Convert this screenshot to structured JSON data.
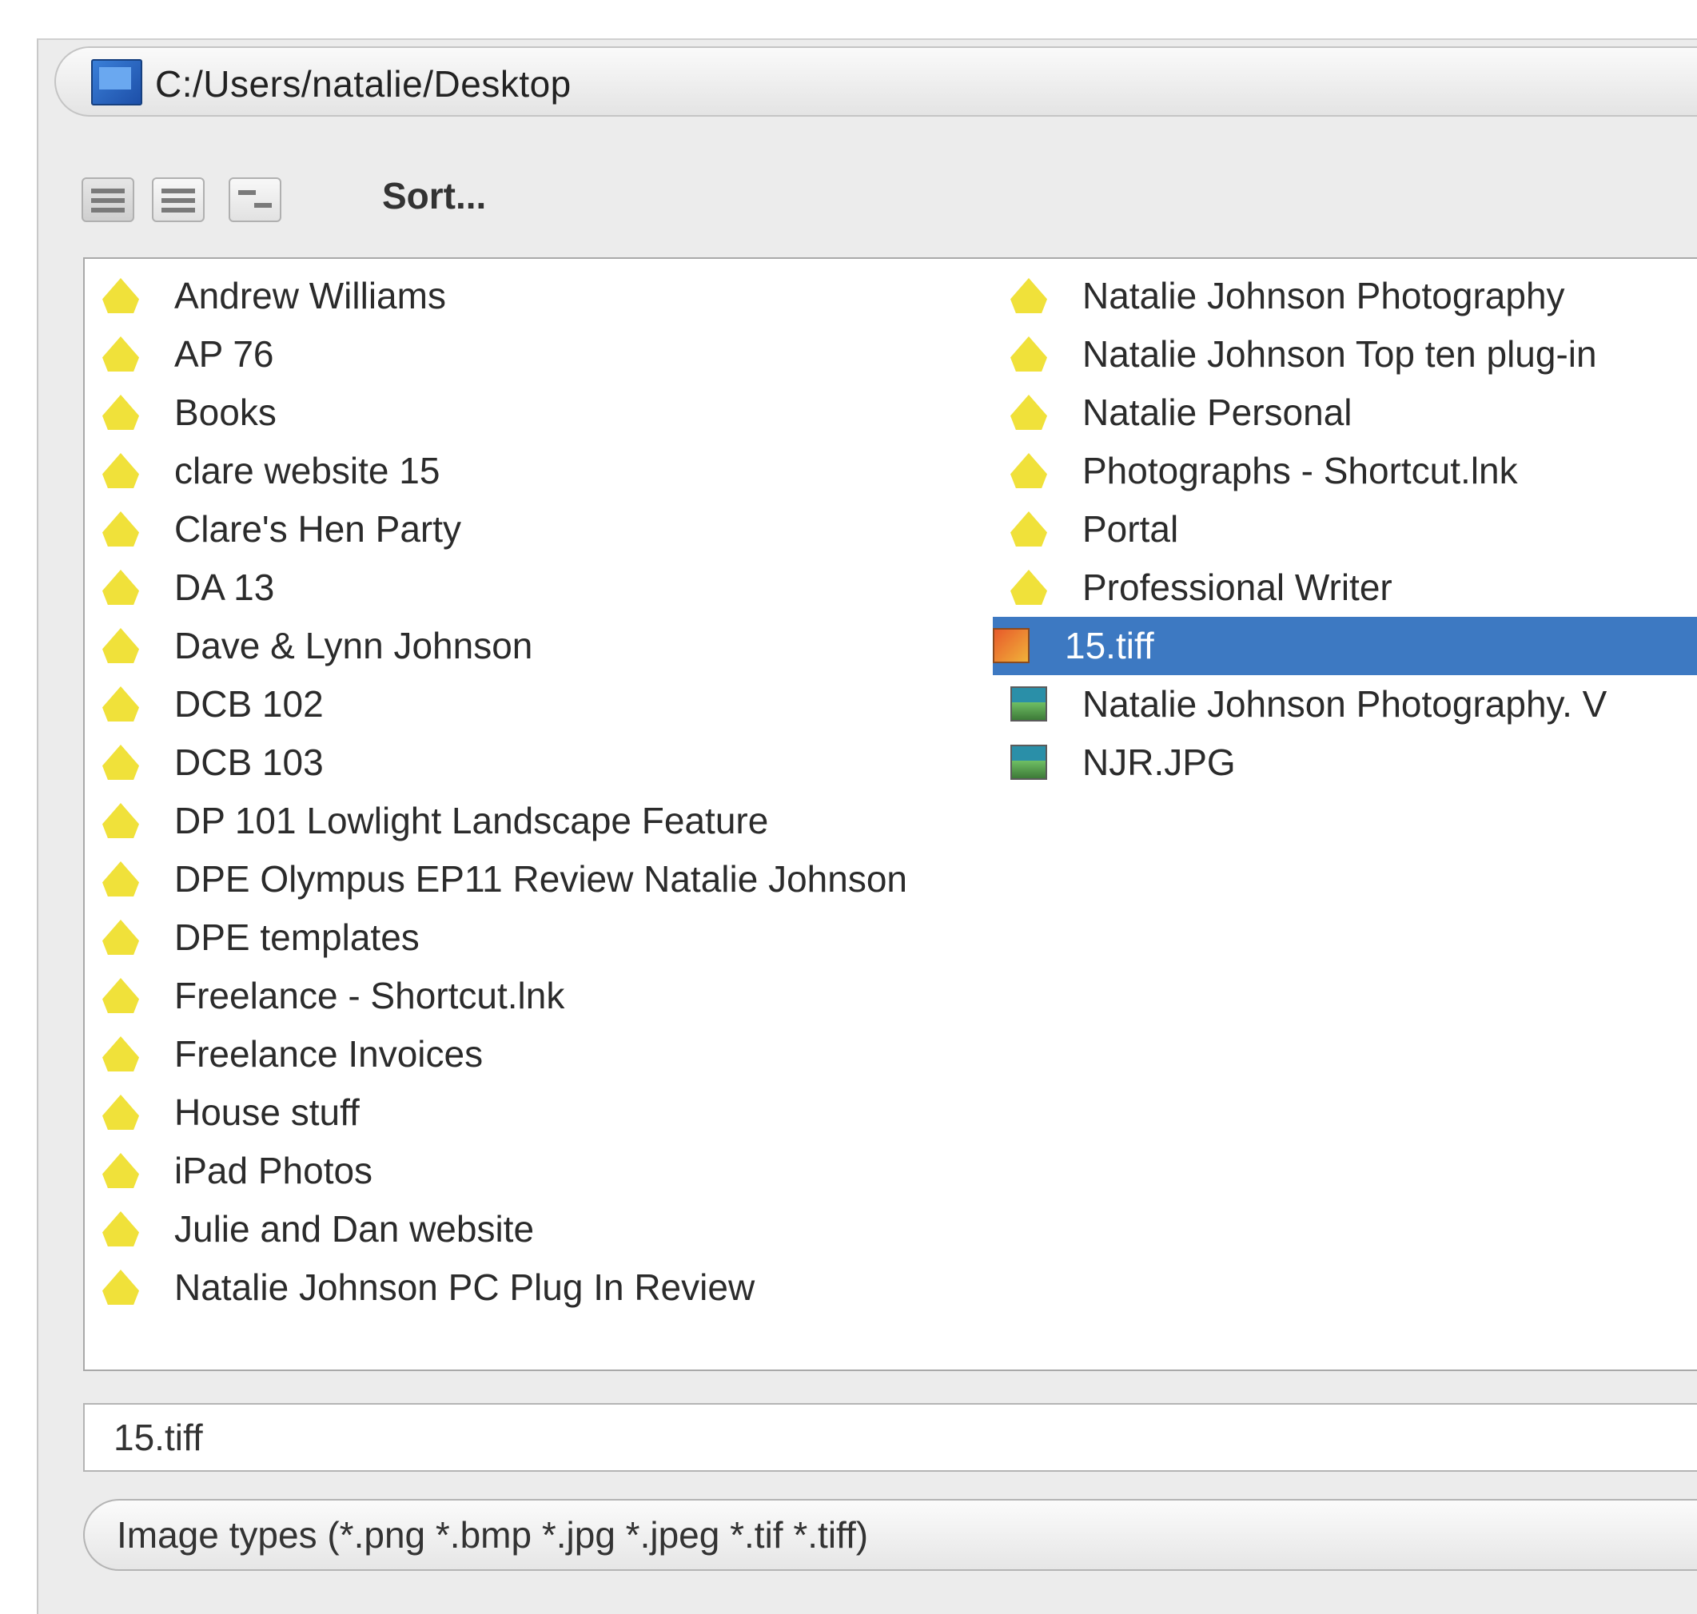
{
  "address_bar": {
    "path": "C:/Users/natalie/Desktop"
  },
  "toolbar": {
    "sort_label": "Sort..."
  },
  "files": {
    "column1": [
      {
        "name": "Andrew Williams",
        "icon": "folder-icon"
      },
      {
        "name": "AP 76",
        "icon": "folder-icon"
      },
      {
        "name": "Books",
        "icon": "folder-icon"
      },
      {
        "name": "clare website 15",
        "icon": "folder-icon"
      },
      {
        "name": "Clare's Hen Party",
        "icon": "folder-icon"
      },
      {
        "name": "DA 13",
        "icon": "folder-icon"
      },
      {
        "name": "Dave & Lynn Johnson",
        "icon": "folder-icon"
      },
      {
        "name": "DCB 102",
        "icon": "folder-icon"
      },
      {
        "name": "DCB 103",
        "icon": "folder-icon"
      },
      {
        "name": "DP 101 Lowlight Landscape Feature",
        "icon": "folder-icon"
      },
      {
        "name": "DPE Olympus EP11 Review Natalie Johnson",
        "icon": "folder-icon"
      },
      {
        "name": "DPE templates",
        "icon": "folder-icon"
      },
      {
        "name": "Freelance - Shortcut.lnk",
        "icon": "folder-icon"
      },
      {
        "name": "Freelance Invoices",
        "icon": "folder-icon"
      },
      {
        "name": "House stuff",
        "icon": "folder-icon"
      },
      {
        "name": "iPad Photos",
        "icon": "folder-icon"
      },
      {
        "name": "Julie and Dan website",
        "icon": "folder-icon"
      },
      {
        "name": "Natalie Johnson PC Plug In Review",
        "icon": "folder-icon"
      }
    ],
    "column2": [
      {
        "name": "Natalie Johnson Photography",
        "icon": "folder-icon"
      },
      {
        "name": "Natalie Johnson Top ten plug-in",
        "icon": "folder-icon"
      },
      {
        "name": "Natalie Personal",
        "icon": "folder-icon"
      },
      {
        "name": "Photographs - Shortcut.lnk",
        "icon": "folder-icon"
      },
      {
        "name": "Portal",
        "icon": "folder-icon"
      },
      {
        "name": "Professional Writer",
        "icon": "folder-icon"
      },
      {
        "name": "15.tiff",
        "icon": "tiff-image-icon",
        "selected": true
      },
      {
        "name": "Natalie Johnson Photography. V",
        "icon": "image-file-icon"
      },
      {
        "name": "NJR.JPG",
        "icon": "image-file-icon"
      }
    ]
  },
  "filename_field": {
    "value": "15.tiff"
  },
  "filetype_select": {
    "value": "Image types (*.png *.bmp *.jpg *.jpeg *.tif *.tiff)"
  },
  "colors": {
    "selection": "#3d79c2",
    "folder": "#f0e13a"
  }
}
